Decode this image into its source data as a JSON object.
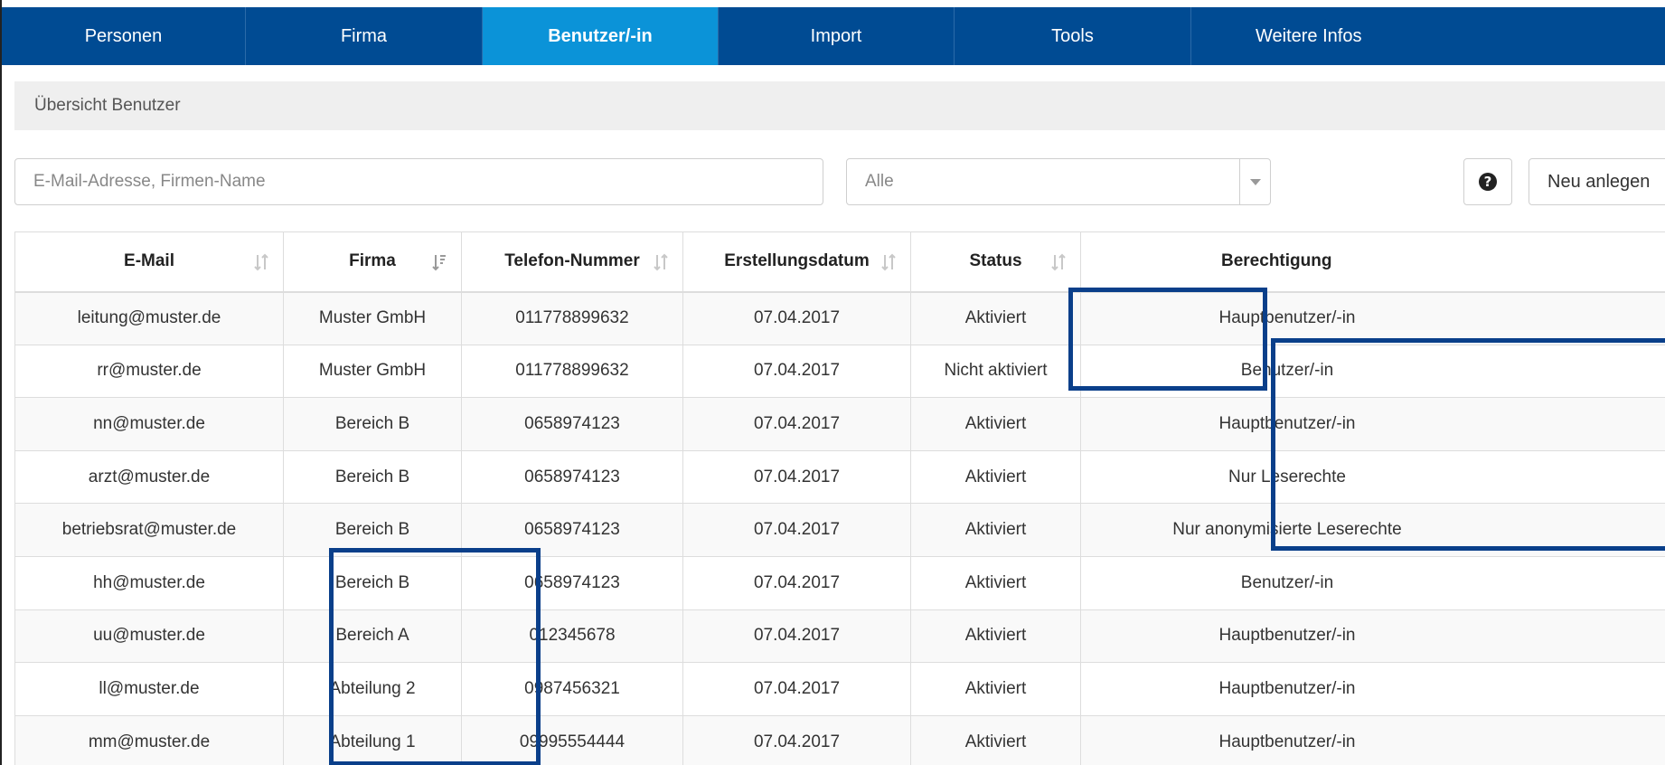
{
  "nav": {
    "tabs": [
      {
        "label": "Personen",
        "active": false
      },
      {
        "label": "Firma",
        "active": false
      },
      {
        "label": "Benutzer/-in",
        "active": true
      },
      {
        "label": "Import",
        "active": false
      },
      {
        "label": "Tools",
        "active": false
      },
      {
        "label": "Weitere Infos",
        "active": false
      }
    ]
  },
  "breadcrumb": "Übersicht Benutzer",
  "filters": {
    "search_placeholder": "E-Mail-Adresse, Firmen-Name",
    "status_select_value": "Alle",
    "help_icon": "question-circle-icon",
    "new_button_label": "Neu anlegen"
  },
  "table": {
    "columns": [
      "E-Mail",
      "Firma",
      "Telefon-Nummer",
      "Erstellungsdatum",
      "Status",
      "Berechtigung"
    ],
    "rows": [
      [
        "leitung@muster.de",
        "Muster GmbH",
        "011778899632",
        "07.04.2017",
        "Aktiviert",
        "Hauptbenutzer/-in"
      ],
      [
        "rr@muster.de",
        "Muster GmbH",
        "011778899632",
        "07.04.2017",
        "Nicht aktiviert",
        "Benutzer/-in"
      ],
      [
        "nn@muster.de",
        "Bereich B",
        "0658974123",
        "07.04.2017",
        "Aktiviert",
        "Hauptbenutzer/-in"
      ],
      [
        "arzt@muster.de",
        "Bereich B",
        "0658974123",
        "07.04.2017",
        "Aktiviert",
        "Nur Leserechte"
      ],
      [
        "betriebsrat@muster.de",
        "Bereich B",
        "0658974123",
        "07.04.2017",
        "Aktiviert",
        "Nur anonymisierte Leserechte"
      ],
      [
        "hh@muster.de",
        "Bereich B",
        "0658974123",
        "07.04.2017",
        "Aktiviert",
        "Benutzer/-in"
      ],
      [
        "uu@muster.de",
        "Bereich A",
        "012345678",
        "07.04.2017",
        "Aktiviert",
        "Hauptbenutzer/-in"
      ],
      [
        "ll@muster.de",
        "Abteilung 2",
        "0987456321",
        "07.04.2017",
        "Aktiviert",
        "Hauptbenutzer/-in"
      ],
      [
        "mm@muster.de",
        "Abteilung 1",
        "09995554444",
        "07.04.2017",
        "Aktiviert",
        "Hauptbenutzer/-in"
      ]
    ]
  },
  "colors": {
    "nav_bg": "#004b93",
    "nav_active_bg": "#0b93d8",
    "highlight_border": "#0a3f8a"
  }
}
